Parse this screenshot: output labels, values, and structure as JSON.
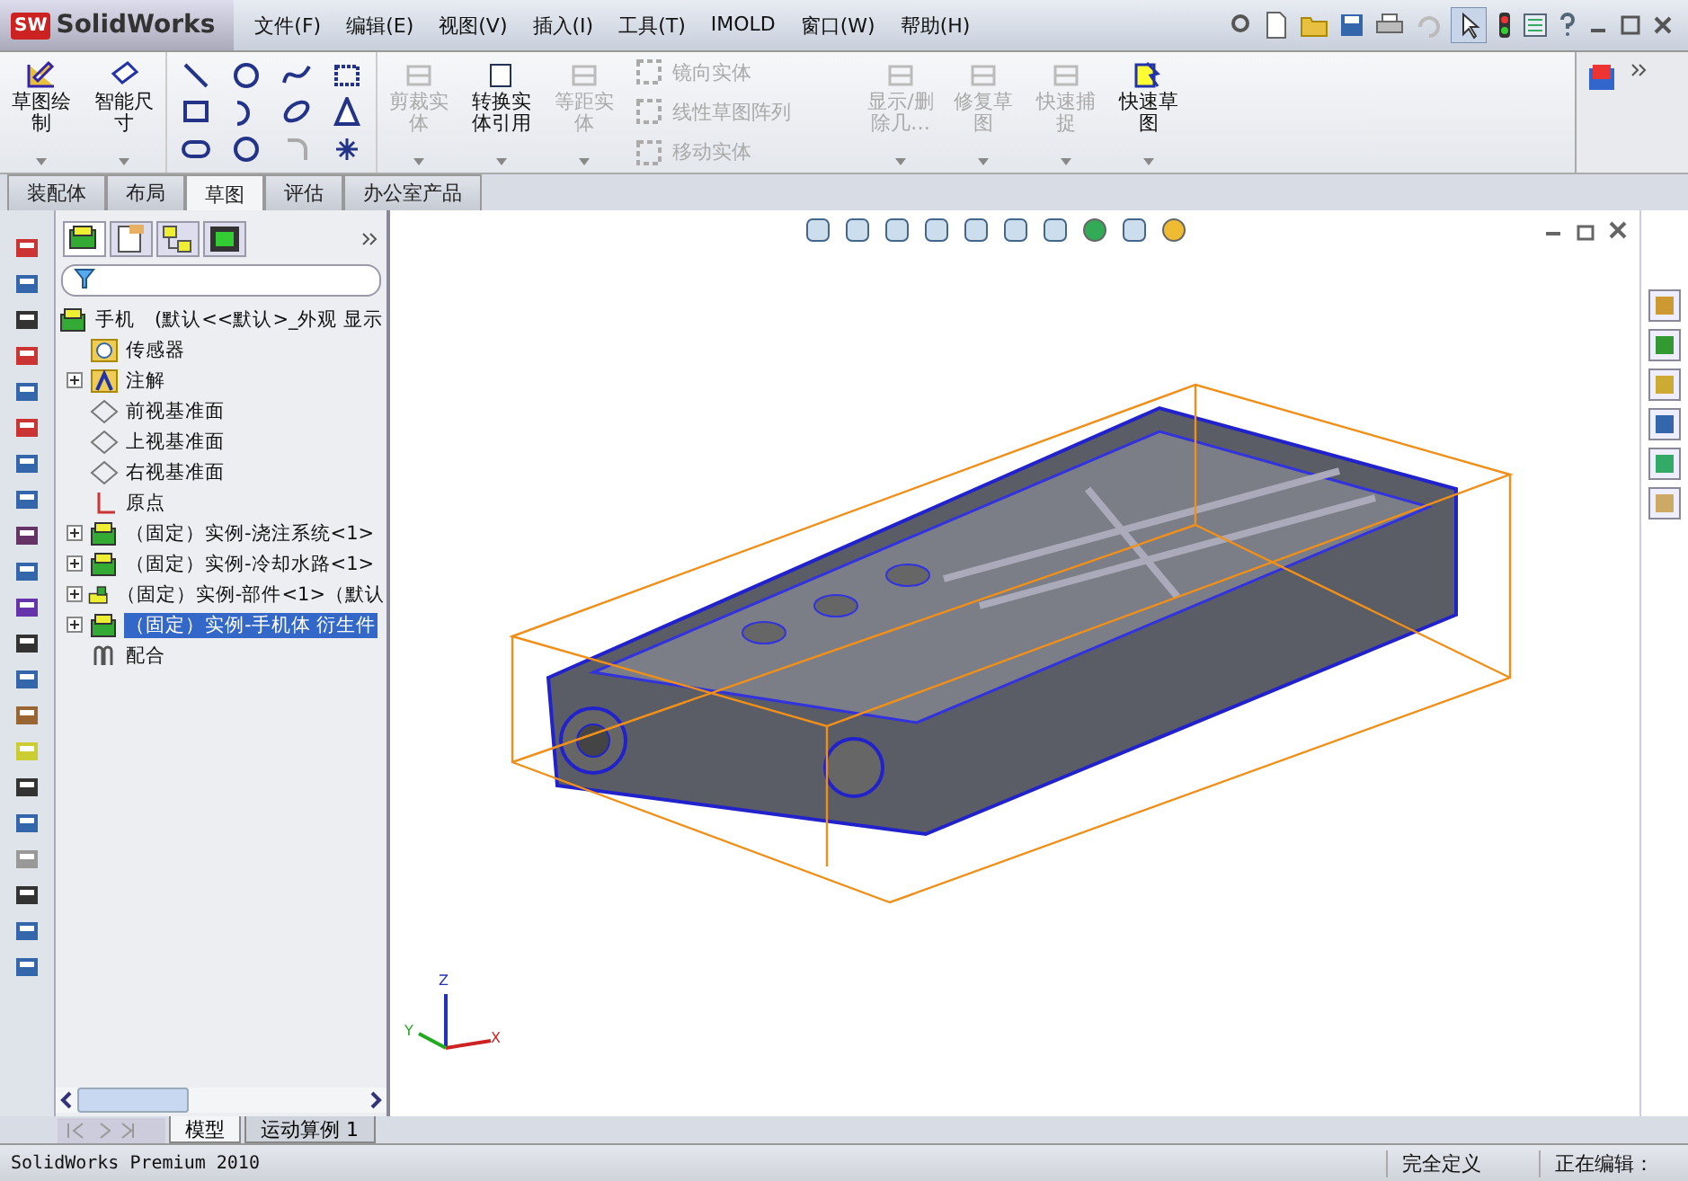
{
  "app": {
    "badge": "SW",
    "logo": "SolidWorks"
  },
  "menu": [
    {
      "label": "文件(F)"
    },
    {
      "label": "编辑(E)"
    },
    {
      "label": "视图(V)"
    },
    {
      "label": "插入(I)"
    },
    {
      "label": "工具(T)"
    },
    {
      "label": "IMOLD"
    },
    {
      "label": "窗口(W)"
    },
    {
      "label": "帮助(H)"
    }
  ],
  "ribbon": [
    {
      "kind": "large",
      "label": "草图绘制",
      "disabled": false
    },
    {
      "kind": "large",
      "label": "智能尺寸",
      "disabled": false
    },
    {
      "kind": "tools"
    },
    {
      "kind": "large",
      "label": "剪裁实体",
      "disabled": true
    },
    {
      "kind": "large",
      "label": "转换实体引用",
      "disabled": false
    },
    {
      "kind": "large",
      "label": "等距实体",
      "disabled": true
    },
    {
      "kind": "stack",
      "items": [
        {
          "label": "镜向实体",
          "disabled": true
        },
        {
          "label": "线性草图阵列",
          "disabled": true
        },
        {
          "label": "移动实体",
          "disabled": true
        }
      ]
    },
    {
      "kind": "large",
      "label": "显示/删除几…",
      "disabled": true
    },
    {
      "kind": "large",
      "label": "修复草图",
      "disabled": true
    },
    {
      "kind": "large",
      "label": "快速捕捉",
      "disabled": true
    },
    {
      "kind": "large",
      "label": "快速草图",
      "disabled": false
    }
  ],
  "command_tabs": [
    {
      "label": "装配体",
      "selected": false
    },
    {
      "label": "布局",
      "selected": false
    },
    {
      "label": "草图",
      "selected": true
    },
    {
      "label": "评估",
      "selected": false
    },
    {
      "label": "办公室产品",
      "selected": false
    }
  ],
  "feature_tree": {
    "label": "手机　(默认<<默认>_外观 显示",
    "children": [
      {
        "kind": "sensor",
        "label": "传感器",
        "expandable": false,
        "selected": false
      },
      {
        "kind": "annotation",
        "label": "注解",
        "expandable": true,
        "selected": false
      },
      {
        "kind": "plane",
        "label": "前视基准面",
        "expandable": false,
        "selected": false
      },
      {
        "kind": "plane",
        "label": "上视基准面",
        "expandable": false,
        "selected": false
      },
      {
        "kind": "plane",
        "label": "右视基准面",
        "expandable": false,
        "selected": false
      },
      {
        "kind": "origin",
        "label": "原点",
        "expandable": false,
        "selected": false
      },
      {
        "kind": "assembly",
        "label": "（固定）实例-浇注系统<1>",
        "expandable": true,
        "selected": false
      },
      {
        "kind": "assembly",
        "label": "（固定）实例-冷却水路<1>",
        "expandable": true,
        "selected": false
      },
      {
        "kind": "part",
        "label": "（固定）实例-部件<1>（默认",
        "expandable": true,
        "selected": false
      },
      {
        "kind": "assembly",
        "label": "（固定）实例-手机体 衍生件",
        "expandable": true,
        "selected": true
      },
      {
        "kind": "mates",
        "label": "配合",
        "expandable": false,
        "selected": false
      }
    ]
  },
  "triad": {
    "y": "Y",
    "z": "Z",
    "x": "X"
  },
  "bottom_tabs": [
    {
      "label": "模型",
      "selected": true
    },
    {
      "label": "运动算例 1",
      "selected": false
    }
  ],
  "status_bar": {
    "product": "SolidWorks Premium 2010",
    "fields": [
      "完全定义",
      "正在编辑："
    ]
  }
}
